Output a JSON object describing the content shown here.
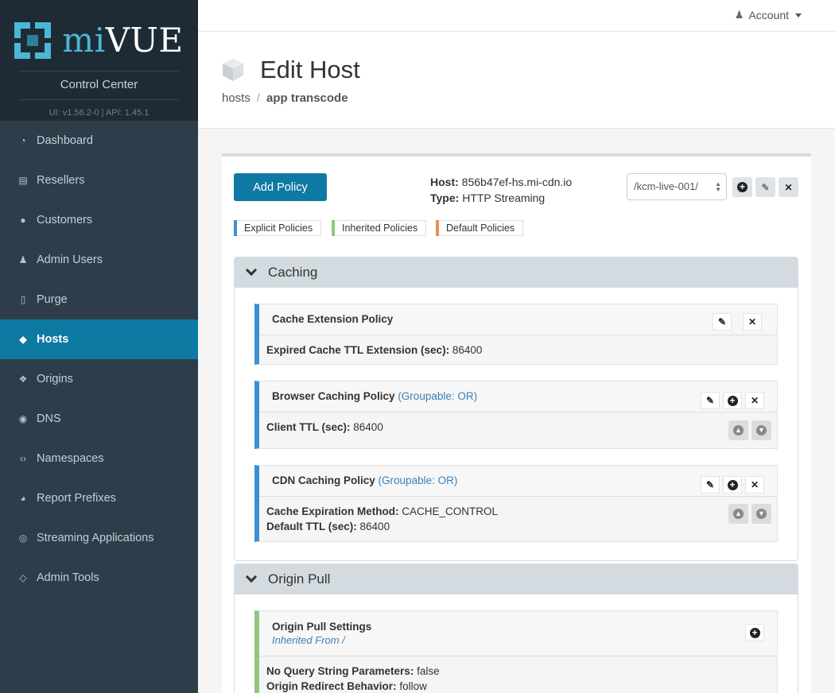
{
  "brand": {
    "logo_prefix": "mi",
    "logo_suffix": "VUE",
    "subtitle": "Control Center",
    "version": "UI: v1.56.2-0  |  API: 1.45.1"
  },
  "nav": [
    {
      "label": "Dashboard",
      "icon": "dashboard-icon"
    },
    {
      "label": "Resellers",
      "icon": "book-icon"
    },
    {
      "label": "Customers",
      "icon": "users-icon"
    },
    {
      "label": "Admin Users",
      "icon": "admin-icon"
    },
    {
      "label": "Purge",
      "icon": "trash-icon"
    },
    {
      "label": "Hosts",
      "icon": "cube-icon",
      "active": true
    },
    {
      "label": "Origins",
      "icon": "cubes-icon"
    },
    {
      "label": "DNS",
      "icon": "globe-icon"
    },
    {
      "label": "Namespaces",
      "icon": "code-icon"
    },
    {
      "label": "Report Prefixes",
      "icon": "compass-icon"
    },
    {
      "label": "Streaming Applications",
      "icon": "target-icon"
    },
    {
      "label": "Admin Tools",
      "icon": "diamond-icon"
    }
  ],
  "topbar": {
    "account_label": "Account"
  },
  "header": {
    "title": "Edit Host",
    "breadcrumb_root": "hosts",
    "breadcrumb_sep": "/",
    "breadcrumb_current": "app transcode"
  },
  "toolbar": {
    "add_policy_label": "Add Policy",
    "host_label": "Host:",
    "host_value": "856b47ef-hs.mi-cdn.io",
    "type_label": "Type:",
    "type_value": "HTTP Streaming",
    "path_select_value": "/kcm-live-001/"
  },
  "legend": {
    "explicit": "Explicit Policies",
    "inherited": "Inherited Policies",
    "default": "Default Policies"
  },
  "caching": {
    "title": "Caching",
    "policies": [
      {
        "name": "Cache Extension Policy",
        "fields": [
          {
            "label": "Expired Cache TTL Extension (sec):",
            "value": "86400"
          }
        ]
      },
      {
        "name": "Browser Caching Policy",
        "group": "(Groupable: OR)",
        "fields": [
          {
            "label": "Client TTL (sec):",
            "value": "86400"
          }
        ]
      },
      {
        "name": "CDN Caching Policy",
        "group": "(Groupable: OR)",
        "fields": [
          {
            "label": "Cache Expiration Method:",
            "value": "CACHE_CONTROL"
          },
          {
            "label": "Default TTL (sec):",
            "value": "86400"
          }
        ]
      }
    ]
  },
  "origin_pull": {
    "title": "Origin Pull",
    "policies": [
      {
        "name": "Origin Pull Settings",
        "inherited_from": "Inherited From /",
        "fields": [
          {
            "label": "No Query String Parameters:",
            "value": "false"
          },
          {
            "label": "Origin Redirect Behavior:",
            "value": "follow"
          }
        ]
      }
    ]
  },
  "colors": {
    "sidebar": "#2d3e4a",
    "accent": "#0e7aa3",
    "explicit": "#3d8fd4",
    "inherited": "#8ec87c",
    "default": "#e98f5c"
  }
}
